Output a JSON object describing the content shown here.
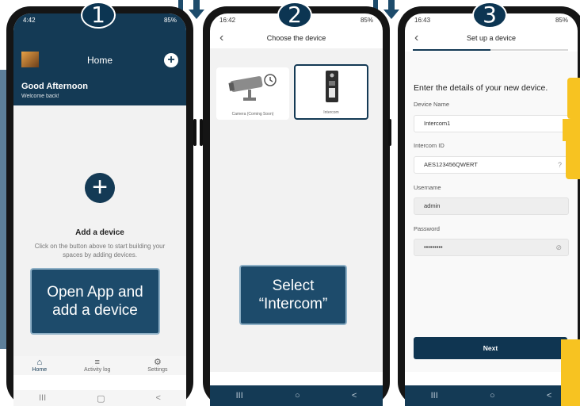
{
  "steps": [
    "1",
    "2",
    "3"
  ],
  "colors": {
    "band": "#5d7f99",
    "brand": "#143a55",
    "callout": "#1d4b6b",
    "accent": "#f7c321"
  },
  "phone1": {
    "status": {
      "time": "4:42",
      "signal": "85%"
    },
    "header": {
      "title": "Home",
      "greeting": "Good Afternoon",
      "subtitle": "Welcome back!",
      "add_icon": "plus-circle-icon"
    },
    "empty_state": {
      "title": "Add a device",
      "description": "Click on the button above to start building your spaces by adding devices."
    },
    "callout": [
      "Open App and",
      "add a device"
    ],
    "nav": [
      {
        "label": "Home",
        "icon": "home-icon"
      },
      {
        "label": "Activity log",
        "icon": "activity-log-icon"
      },
      {
        "label": "Settings",
        "icon": "gear-icon"
      }
    ],
    "sysbar": [
      "III",
      "▢",
      "<"
    ]
  },
  "phone2": {
    "status": {
      "time": "16:42",
      "signal": "85%"
    },
    "title": "Choose the device",
    "devices": [
      {
        "label": "Camera (Coming Soon)",
        "icon": "camera-icon"
      },
      {
        "label": "Intercom",
        "icon": "intercom-icon"
      }
    ],
    "callout": [
      "Select",
      "“Intercom”"
    ],
    "sysbar": [
      "III",
      "○",
      "<"
    ]
  },
  "phone3": {
    "status": {
      "time": "16:43",
      "signal": "85%"
    },
    "title": "Set up a device",
    "progress": 0.5,
    "lead": "Enter the details of your new device.",
    "fields": [
      {
        "label": "Device Name",
        "value": "Intercom1"
      },
      {
        "label": "Intercom ID",
        "value": "AES123456QWERT",
        "icon": "help-icon"
      },
      {
        "label": "Username",
        "value": "admin"
      },
      {
        "label": "Password",
        "value": "•••••••••",
        "icon": "eye-off-icon"
      }
    ],
    "next_label": "Next",
    "sysbar": [
      "III",
      "○",
      "<"
    ]
  }
}
